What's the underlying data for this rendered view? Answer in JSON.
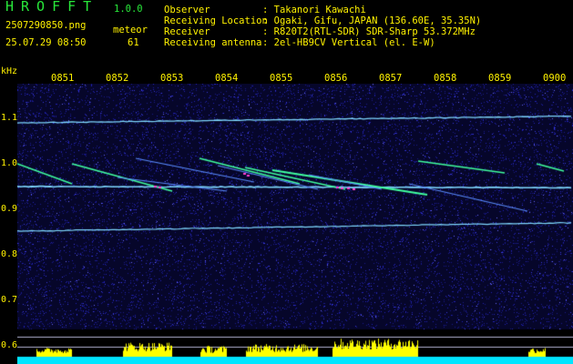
{
  "header": {
    "app_title": "HROFFT",
    "app_version": "1.0.0",
    "file_name": "2507290850.png",
    "timestamp": "25.07.29 08:50",
    "meteor_label": "meteor",
    "meteor_count": "61"
  },
  "info": [
    {
      "key": "Observer",
      "value": ": Takanori Kawachi"
    },
    {
      "key": "Receiving Location",
      "value": ": Ogaki, Gifu, JAPAN (136.60E, 35.35N)"
    },
    {
      "key": "Receiver",
      "value": ": R820T2(RTL-SDR) SDR-Sharp 53.372MHz"
    },
    {
      "key": "Receiving antenna",
      "value": ": 2el-HB9CV Vertical (el. E-W)"
    }
  ],
  "axis": {
    "unit_label": "kHz",
    "time_ticks": [
      "0851",
      "0852",
      "0853",
      "0854",
      "0855",
      "0856",
      "0857",
      "0858",
      "0859",
      "0900"
    ],
    "freq_ticks": [
      "1.1",
      "1.0",
      "0.9",
      "0.8",
      "0.7",
      "0.6"
    ]
  },
  "colors": {
    "green": "#28e83a",
    "yellow": "#fff200",
    "background": "#000000",
    "noise": "#1a1aa0",
    "trace": "#7fd8ff",
    "meteor": "#40ffa0",
    "activity_fill": "#ffff00",
    "baseline": "#00e5ff"
  }
}
